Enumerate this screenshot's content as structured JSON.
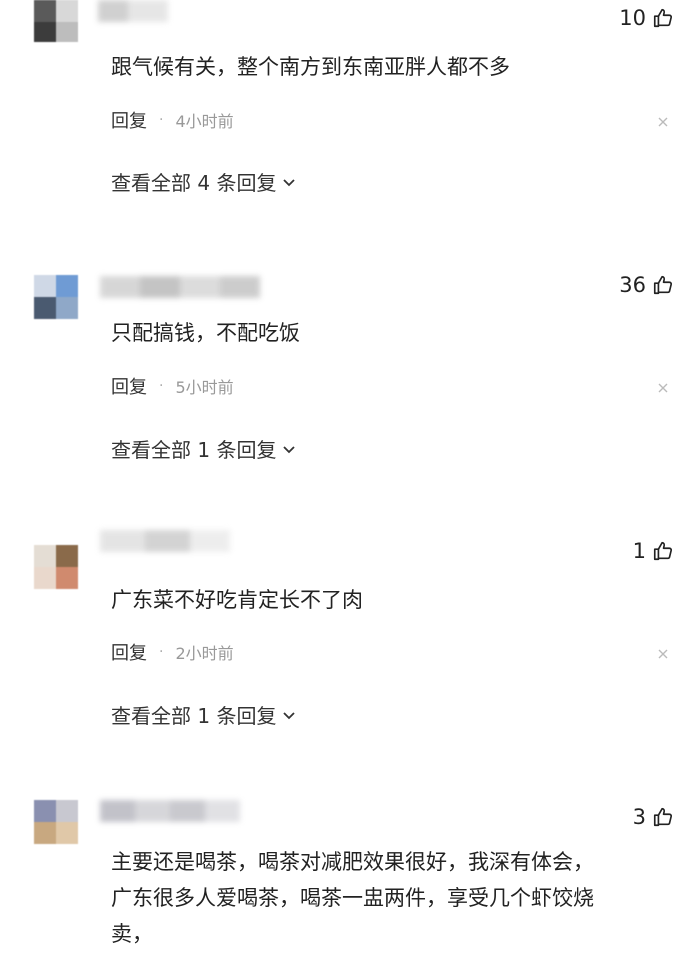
{
  "comments": [
    {
      "likes": "10",
      "text": "跟气候有关，整个南方到东南亚胖人都不多",
      "reply_label": "回复",
      "separator": "·",
      "time": "4小时前",
      "view_all": "查看全部 4 条回复",
      "avatar_colors": [
        "#5a5a5a",
        "#d8d8d8",
        "#3c3c3c",
        "#bdbdbd"
      ]
    },
    {
      "likes": "36",
      "text": "只配搞钱，不配吃饭",
      "reply_label": "回复",
      "separator": "·",
      "time": "5小时前",
      "view_all": "查看全部 1 条回复",
      "avatar_colors": [
        "#cfd8e6",
        "#6f9bd4",
        "#4a5a70",
        "#8fa8c8"
      ]
    },
    {
      "likes": "1",
      "text": "广东菜不好吃肯定长不了肉",
      "reply_label": "回复",
      "separator": "·",
      "time": "2小时前",
      "view_all": "查看全部 1 条回复",
      "avatar_colors": [
        "#e4ddd4",
        "#8a6a4a",
        "#e9d8cc",
        "#d08a6e"
      ]
    },
    {
      "likes": "3",
      "text": "主要还是喝茶，喝茶对减肥效果很好，我深有体会，\n广东很多人爱喝茶，喝茶一盅两件，享受几个虾饺烧\n卖，",
      "avatar_colors": [
        "#8a90b0",
        "#c8c8d0",
        "#c8a880",
        "#e0c8a8"
      ]
    }
  ],
  "icons": {
    "like": "thumbs-up-icon",
    "close": "close-icon",
    "expand": "chevron-down-icon"
  }
}
